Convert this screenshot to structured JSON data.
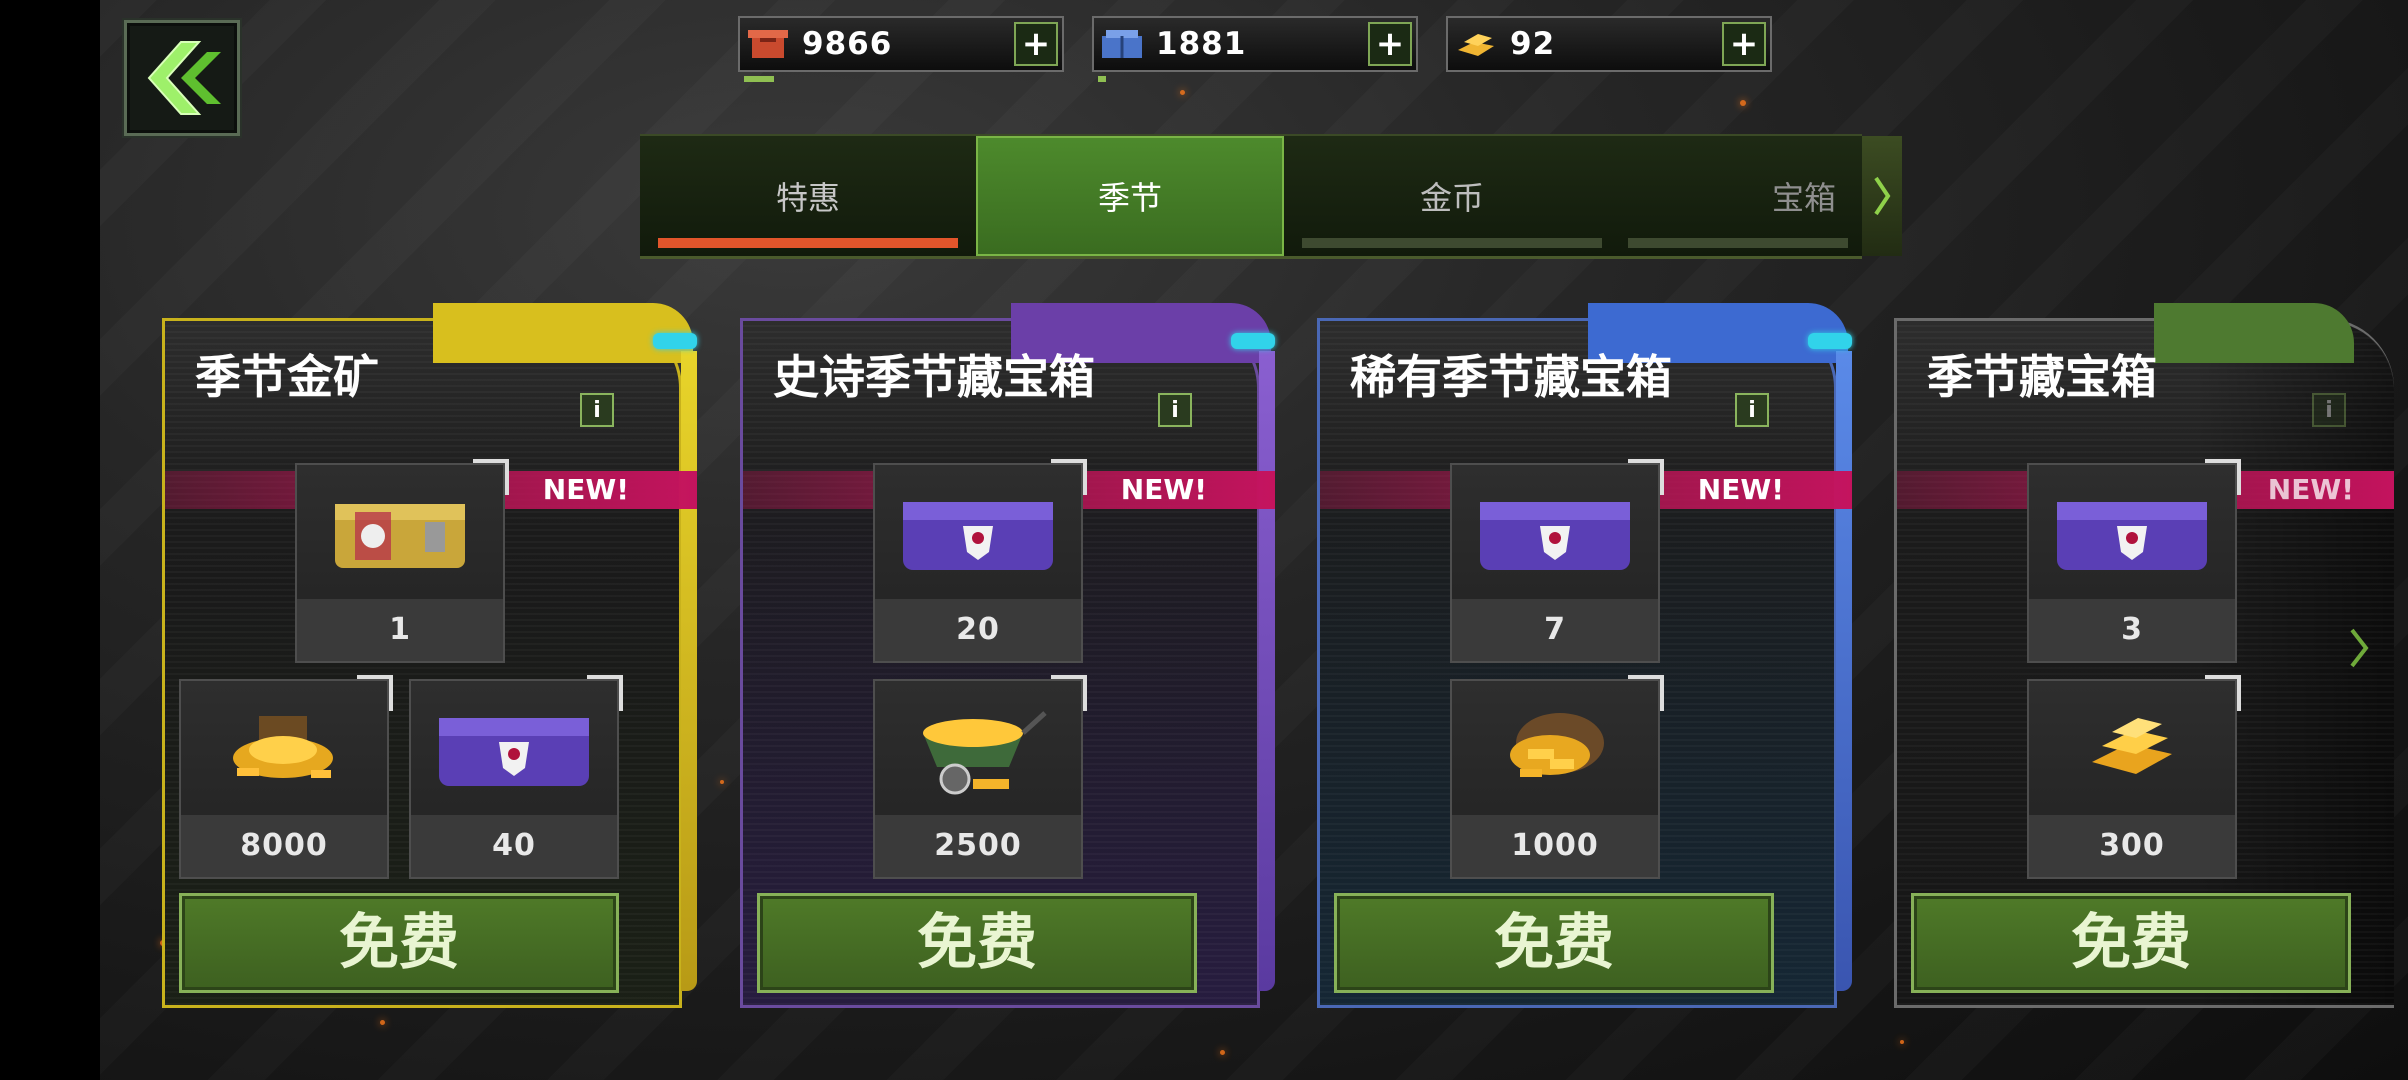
{
  "resources": [
    {
      "icon": "red-crate-icon",
      "value": "9866"
    },
    {
      "icon": "blue-crate-icon",
      "value": "1881"
    },
    {
      "icon": "gold-bars-icon",
      "value": "92"
    }
  ],
  "tabs": [
    {
      "label": "特惠"
    },
    {
      "label": "季节"
    },
    {
      "label": "金币"
    },
    {
      "label": "宝箱"
    }
  ],
  "cards": [
    {
      "title": "季节金矿",
      "badge": "NEW!",
      "info": "i",
      "accent": "#d8bf1e",
      "slots": [
        {
          "icon": "yellow-crate-icon",
          "amount": "1"
        },
        {
          "icon": "gold-pile-icon",
          "amount": "8000"
        },
        {
          "icon": "purple-chest-icon",
          "amount": "40"
        }
      ],
      "button": "免费"
    },
    {
      "title": "史诗季节藏宝箱",
      "badge": "NEW!",
      "info": "i",
      "accent": "#6b3fa8",
      "slots": [
        {
          "icon": "purple-chest-icon",
          "amount": "20"
        },
        {
          "icon": "gold-wheelbarrow-icon",
          "amount": "2500"
        }
      ],
      "button": "免费"
    },
    {
      "title": "稀有季节藏宝箱",
      "badge": "NEW!",
      "info": "i",
      "accent": "#3d6ad1",
      "slots": [
        {
          "icon": "purple-chest-icon",
          "amount": "7"
        },
        {
          "icon": "gold-sack-icon",
          "amount": "1000"
        }
      ],
      "button": "免费"
    },
    {
      "title": "季节藏宝箱",
      "badge": "NEW!",
      "info": "i",
      "accent": "#5d8a35",
      "slots": [
        {
          "icon": "purple-chest-icon",
          "amount": "3"
        },
        {
          "icon": "gold-bars-icon",
          "amount": "300"
        }
      ],
      "button": "免费"
    }
  ]
}
